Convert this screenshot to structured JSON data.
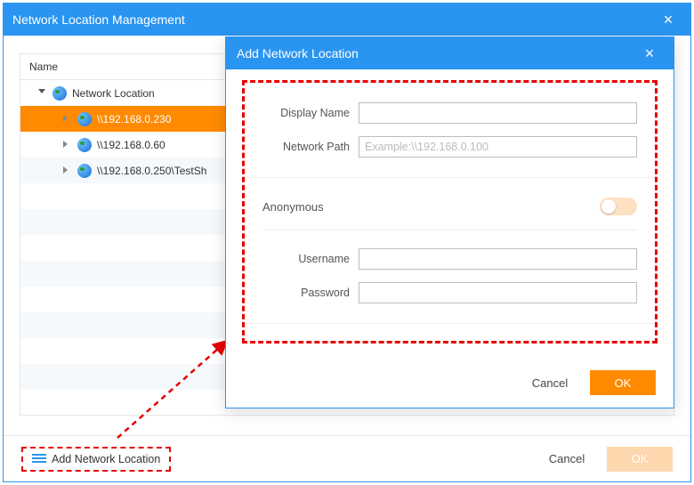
{
  "main": {
    "title": "Network Location Management",
    "name_header": "Name",
    "root_label": "Network Location",
    "items": [
      {
        "label": "\\\\192.168.0.230",
        "selected": true
      },
      {
        "label": "\\\\192.168.0.60",
        "selected": false
      },
      {
        "label": "\\\\192.168.0.250\\TestSh",
        "selected": false
      }
    ],
    "add_label": "Add Network Location",
    "cancel": "Cancel",
    "ok": "OK"
  },
  "dialog": {
    "title": "Add Network Location",
    "display_name_label": "Display Name",
    "network_path_label": "Network Path",
    "network_path_placeholder": "Example:\\\\192.168.0.100",
    "anonymous_label": "Anonymous",
    "anonymous_on": false,
    "username_label": "Username",
    "password_label": "Password",
    "cancel": "Cancel",
    "ok": "OK",
    "fields": {
      "display_name": "",
      "network_path": "",
      "username": "",
      "password": ""
    }
  }
}
